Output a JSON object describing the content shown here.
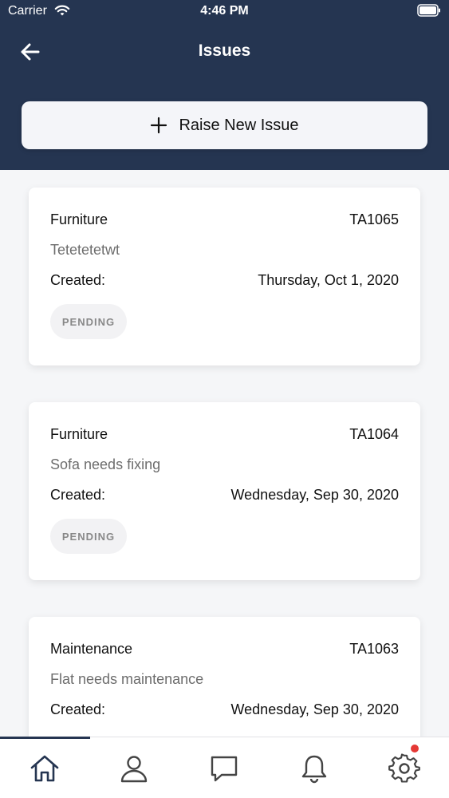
{
  "status_bar": {
    "carrier": "Carrier",
    "time": "4:46 PM"
  },
  "header": {
    "title": "Issues",
    "back_icon": "arrow-left-icon"
  },
  "raise_button": {
    "label": "Raise New Issue",
    "icon": "plus-icon"
  },
  "issues": [
    {
      "category": "Furniture",
      "id": "TA1065",
      "description": "Tetetetetwt",
      "created_label": "Created:",
      "created_date": "Thursday, Oct 1, 2020",
      "status": "PENDING"
    },
    {
      "category": "Furniture",
      "id": "TA1064",
      "description": "Sofa needs fixing",
      "created_label": "Created:",
      "created_date": "Wednesday, Sep 30, 2020",
      "status": "PENDING"
    },
    {
      "category": "Maintenance",
      "id": "TA1063",
      "description": "Flat needs maintenance",
      "created_label": "Created:",
      "created_date": "Wednesday, Sep 30, 2020",
      "status": ""
    }
  ],
  "tab_bar": {
    "active": "home",
    "tabs": [
      {
        "name": "home",
        "icon": "home-icon"
      },
      {
        "name": "profile",
        "icon": "user-icon"
      },
      {
        "name": "messages",
        "icon": "chat-icon"
      },
      {
        "name": "notifications",
        "icon": "bell-icon"
      },
      {
        "name": "settings",
        "icon": "gear-icon"
      }
    ]
  },
  "colors": {
    "header_bg": "#253551",
    "page_bg": "#f5f6f8",
    "card_bg": "#ffffff",
    "pill_bg": "#f2f2f4",
    "muted_text": "#6d6d6d",
    "notification_dot": "#e53935"
  }
}
